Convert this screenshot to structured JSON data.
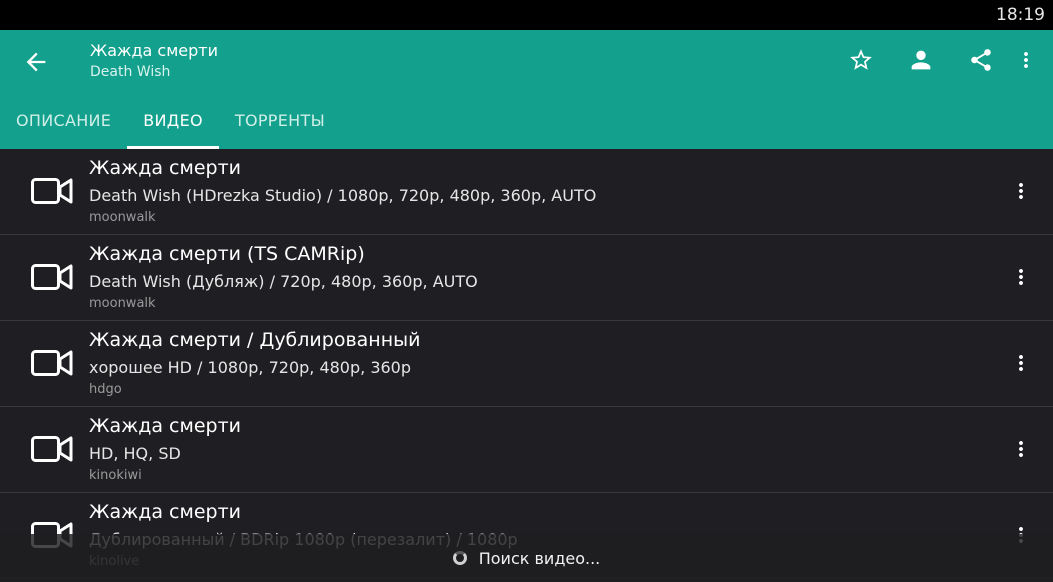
{
  "status": {
    "time": "18:19"
  },
  "header": {
    "title": "Жажда смерти",
    "subtitle": "Death Wish",
    "actions": [
      "star-icon",
      "person-icon",
      "share-icon",
      "more-vert-icon"
    ]
  },
  "tabs": [
    {
      "label": "ОПИСАНИЕ",
      "active": false
    },
    {
      "label": "ВИДЕО",
      "active": true
    },
    {
      "label": "ТОРРЕНТЫ",
      "active": false
    }
  ],
  "items": [
    {
      "title": "Жажда смерти",
      "details": "Death Wish (HDrezka Studio) / 1080p, 720p, 480p, 360p, AUTO",
      "source": "moonwalk"
    },
    {
      "title": "Жажда смерти (TS CAMRip)",
      "details": "Death Wish (Дубляж) / 720p, 480p, 360p, AUTO",
      "source": "moonwalk"
    },
    {
      "title": "Жажда смерти / Дублированный",
      "details": "хорошее HD / 1080p, 720p, 480p, 360p",
      "source": "hdgo"
    },
    {
      "title": "Жажда смерти",
      "details": "HD, HQ, SD",
      "source": "kinokiwi"
    },
    {
      "title": "Жажда смерти",
      "details": "Дублированный / BDRip 1080p (перезалит) / 1080p",
      "source": "kinolive"
    }
  ],
  "toast": {
    "text": "Поиск видео..."
  },
  "colors": {
    "appbar": "#13a08c",
    "background": "#1f1f23",
    "statusbar": "#000000"
  }
}
